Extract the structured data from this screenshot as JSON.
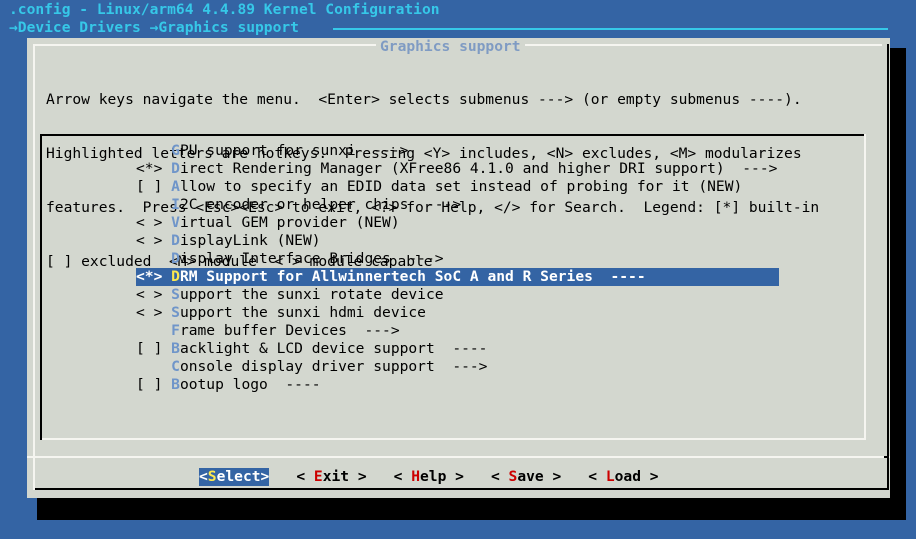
{
  "window": {
    "title": ".config - Linux/arm64 4.4.89 Kernel Configuration",
    "breadcrumb": "→Device Drivers →Graphics support"
  },
  "dialog": {
    "title": "Graphics support",
    "help_lines": [
      "Arrow keys navigate the menu.  <Enter> selects submenus ---> (or empty submenus ----).",
      "Highlighted letters are hotkeys.  Pressing <Y> includes, <N> excludes, <M> modularizes",
      "features.  Press <Esc><Esc> to exit, <?> for Help, </> for Search.  Legend: [*] built-in",
      "[ ] excluded  <M> module  < > module capable"
    ]
  },
  "menu": {
    "selected_index": 7,
    "items": [
      {
        "prefix": "    ",
        "hotkey": "G",
        "rest": "PU support for sunxi  --->"
      },
      {
        "prefix": "<*> ",
        "hotkey": "D",
        "rest": "irect Rendering Manager (XFree86 4.1.0 and higher DRI support)  --->"
      },
      {
        "prefix": "[ ] ",
        "hotkey": "A",
        "rest": "llow to specify an EDID data set instead of probing for it (NEW)"
      },
      {
        "prefix": "    ",
        "hotkey": "I",
        "rest": "2C encoder or helper chips  --->"
      },
      {
        "prefix": "< > ",
        "hotkey": "V",
        "rest": "irtual GEM provider (NEW)"
      },
      {
        "prefix": "< > ",
        "hotkey": "D",
        "rest": "isplayLink (NEW)"
      },
      {
        "prefix": "    ",
        "hotkey": "D",
        "rest": "isplay Interface Bridges  --->"
      },
      {
        "prefix": "<*> ",
        "hotkey": "D",
        "rest": "RM Support for Allwinnertech SoC A and R Series  ----"
      },
      {
        "prefix": "< > ",
        "hotkey": "S",
        "rest": "upport the sunxi rotate device"
      },
      {
        "prefix": "< > ",
        "hotkey": "S",
        "rest": "upport the sunxi hdmi device"
      },
      {
        "prefix": "    ",
        "hotkey": "F",
        "rest": "rame buffer Devices  --->"
      },
      {
        "prefix": "[ ] ",
        "hotkey": "B",
        "rest": "acklight & LCD device support  ----"
      },
      {
        "prefix": "    ",
        "hotkey": "C",
        "rest": "onsole display driver support  --->"
      },
      {
        "prefix": "[ ] ",
        "hotkey": "B",
        "rest": "ootup logo  ----"
      }
    ]
  },
  "buttons": [
    {
      "open": "<",
      "hotkey": "S",
      "rest": "elect",
      "close": ">",
      "active": true
    },
    {
      "open": "< ",
      "hotkey": "E",
      "rest": "xit",
      "close": " >",
      "active": false
    },
    {
      "open": "< ",
      "hotkey": "H",
      "rest": "elp",
      "close": " >",
      "active": false
    },
    {
      "open": "< ",
      "hotkey": "S",
      "rest": "ave",
      "close": " >",
      "active": false
    },
    {
      "open": "< ",
      "hotkey": "L",
      "rest": "oad",
      "close": " >",
      "active": false
    }
  ],
  "colors": {
    "background": "#3464a4",
    "header_text": "#36c8e8",
    "dialog_bg": "#d3d7cf",
    "selection_bg": "#3464a4",
    "selected_hotkey": "#fce94f",
    "button_hotkey": "#cc0000"
  }
}
